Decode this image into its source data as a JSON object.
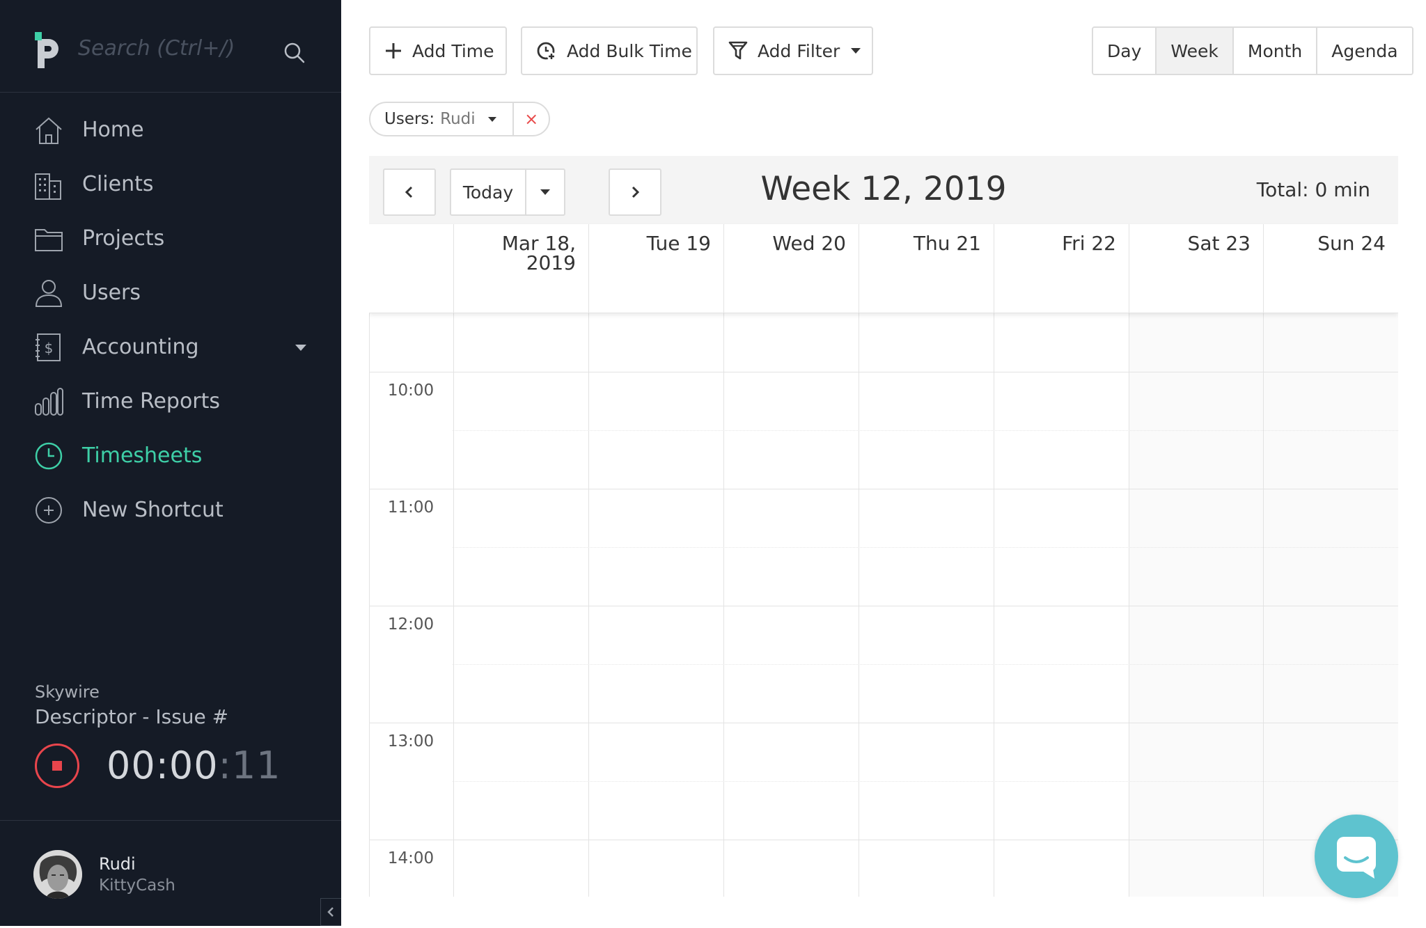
{
  "sidebar": {
    "search": {
      "placeholder": "Search (Ctrl+/)"
    },
    "nav": [
      {
        "label": "Home",
        "icon": "home-icon"
      },
      {
        "label": "Clients",
        "icon": "building-icon"
      },
      {
        "label": "Projects",
        "icon": "folder-icon"
      },
      {
        "label": "Users",
        "icon": "user-icon"
      },
      {
        "label": "Accounting",
        "icon": "ledger-dollar-icon",
        "has_dropdown": true
      },
      {
        "label": "Time Reports",
        "icon": "bar-chart-icon"
      },
      {
        "label": "Timesheets",
        "icon": "clock-icon",
        "active": true
      },
      {
        "label": "New Shortcut",
        "icon": "plus-circle-icon"
      }
    ],
    "timer": {
      "client": "Skywire",
      "task": "Descriptor - Issue #",
      "time_main": "00:00",
      "time_seconds": ":11"
    },
    "user": {
      "name": "Rudi",
      "org": "KittyCash"
    }
  },
  "toolbar": {
    "add_time": "Add Time",
    "add_bulk_time": "Add Bulk Time",
    "add_filter": "Add Filter",
    "views": [
      "Day",
      "Week",
      "Month",
      "Agenda"
    ],
    "active_view": "Week"
  },
  "filter_chip": {
    "key": "Users:",
    "value": "Rudi",
    "remove": "×"
  },
  "calendar": {
    "today_label": "Today",
    "title": "Week 12, 2019",
    "total_label": "Total:",
    "total_value": "0 min",
    "days": [
      {
        "line1": "Mar 18,",
        "line2": "2019"
      },
      {
        "line1": "Tue 19",
        "line2": ""
      },
      {
        "line1": "Wed 20",
        "line2": ""
      },
      {
        "line1": "Thu 21",
        "line2": ""
      },
      {
        "line1": "Fri 22",
        "line2": ""
      },
      {
        "line1": "Sat 23",
        "line2": ""
      },
      {
        "line1": "Sun 24",
        "line2": ""
      }
    ],
    "hours": [
      "10:00",
      "11:00",
      "12:00",
      "13:00",
      "14:00"
    ]
  },
  "colors": {
    "sidebar_bg": "#151b26",
    "accent": "#3ecfa7",
    "stop_red": "#e8454c",
    "chat_bubble": "#5ec3cf"
  }
}
